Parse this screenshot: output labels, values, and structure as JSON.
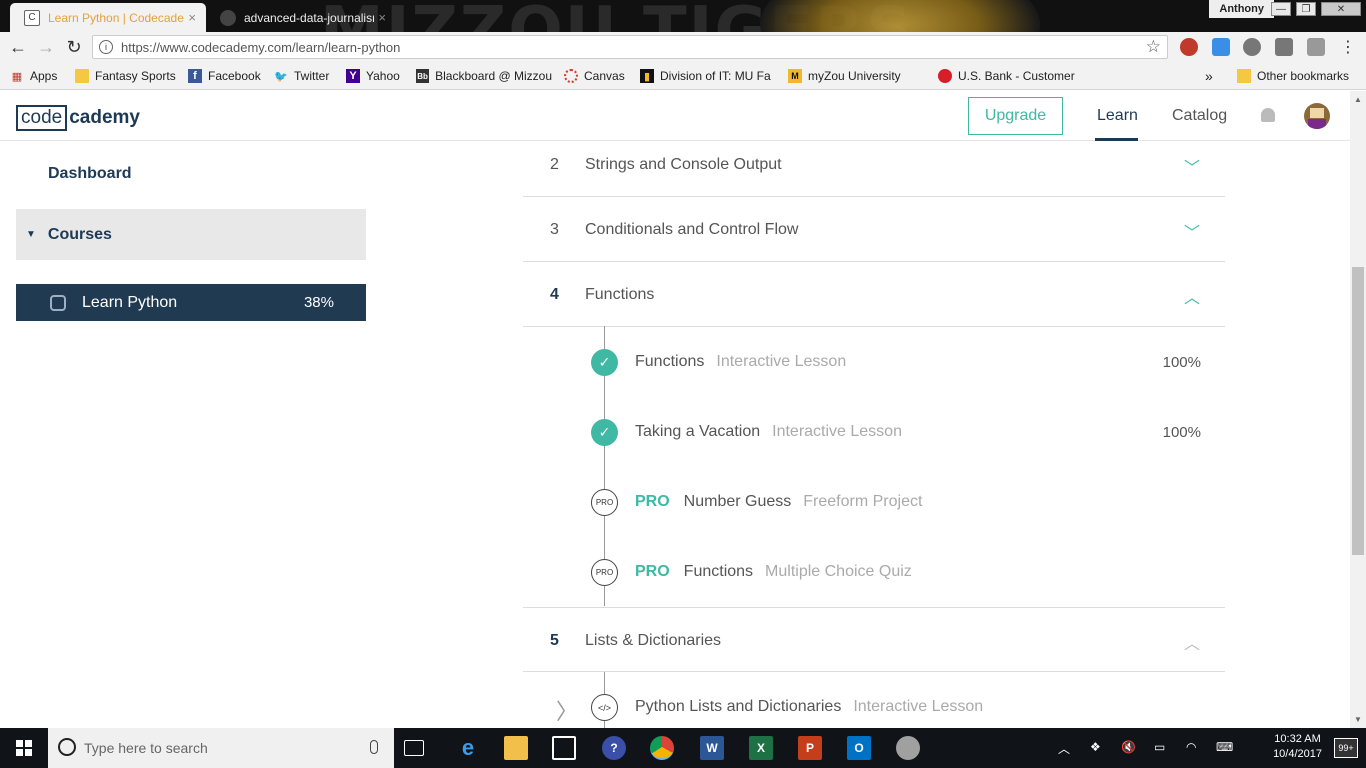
{
  "browser": {
    "tabs": [
      {
        "title": "Learn Python | Codecademy",
        "active": true,
        "icon": "codecademy-favicon"
      },
      {
        "title": "advanced-data-journalism",
        "active": false,
        "icon": "github-favicon"
      }
    ],
    "tab_close": "×",
    "user": "Anthony",
    "url": "https://www.codecademy.com/learn/learn-python",
    "bookmarks": [
      {
        "label": "Apps",
        "icon": "apps-grid-icon"
      },
      {
        "label": "Fantasy Sports",
        "icon": "folder-icon"
      },
      {
        "label": "Facebook",
        "icon": "facebook-icon"
      },
      {
        "label": "Twitter",
        "icon": "twitter-icon"
      },
      {
        "label": "Yahoo",
        "icon": "yahoo-icon"
      },
      {
        "label": "Blackboard @ Mizzou",
        "icon": "blackboard-icon"
      },
      {
        "label": "Canvas",
        "icon": "canvas-icon"
      },
      {
        "label": "Division of IT: MU Fa",
        "icon": "division-it-icon"
      },
      {
        "label": "myZou University",
        "icon": "myzou-icon"
      },
      {
        "label": "U.S. Bank - Customer",
        "icon": "usbank-icon"
      }
    ],
    "bookmarks_overflow": "»",
    "other_bookmarks": "Other bookmarks"
  },
  "header": {
    "logo_box": "code",
    "logo_rest": "cademy",
    "upgrade_label": "Upgrade",
    "nav": [
      {
        "label": "Learn",
        "active": true
      },
      {
        "label": "Catalog",
        "active": false
      }
    ]
  },
  "sidebar": {
    "dashboard": "Dashboard",
    "courses": "Courses",
    "course": {
      "name": "Learn Python",
      "progress": "38%"
    }
  },
  "units": [
    {
      "num": "2",
      "title": "Strings and Console Output",
      "expanded": false
    },
    {
      "num": "3",
      "title": "Conditionals and Control Flow",
      "expanded": false
    },
    {
      "num": "4",
      "title": "Functions",
      "expanded": true
    },
    {
      "num": "5",
      "title": "Lists & Dictionaries",
      "expanded": true
    }
  ],
  "lessons": [
    {
      "status": "done",
      "name": "Functions",
      "type": "Interactive Lesson",
      "progress": "100%"
    },
    {
      "status": "done",
      "name": "Taking a Vacation",
      "type": "Interactive Lesson",
      "progress": "100%"
    },
    {
      "status": "pro",
      "pro_label": "PRO",
      "badge": "PRO",
      "name": "Number Guess",
      "type": "Freeform Project"
    },
    {
      "status": "pro",
      "pro_label": "PRO",
      "badge": "PRO",
      "name": "Functions",
      "type": "Multiple Choice Quiz"
    },
    {
      "status": "code",
      "badge": "</>",
      "name": "Python Lists and Dictionaries",
      "type": "Interactive Lesson"
    }
  ],
  "taskbar": {
    "search_placeholder": "Type here to search",
    "time": "10:32 AM",
    "date": "10/4/2017",
    "notifications": "99+"
  }
}
